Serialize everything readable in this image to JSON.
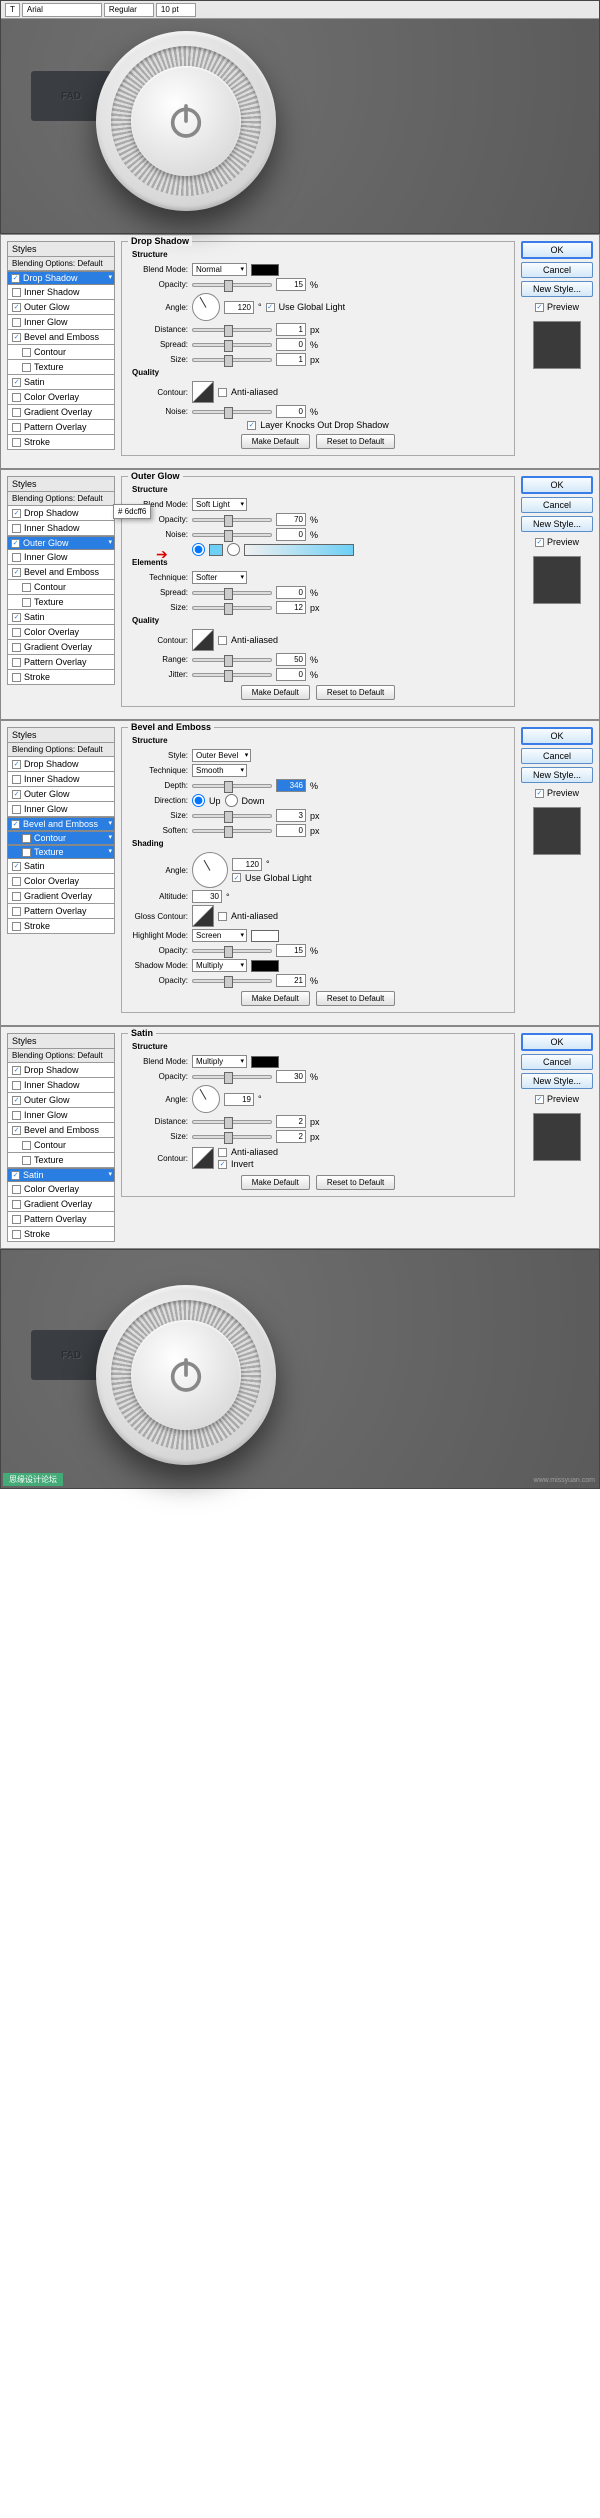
{
  "toolbar": {
    "font": "Arial",
    "weight": "Regular",
    "size": "10 pt",
    "unit": "T"
  },
  "fad": "FAD",
  "styles": {
    "header": "Styles",
    "blending": "Blending Options: Default",
    "items": [
      "Drop Shadow",
      "Inner Shadow",
      "Outer Glow",
      "Inner Glow",
      "Bevel and Emboss",
      "Contour",
      "Texture",
      "Satin",
      "Color Overlay",
      "Gradient Overlay",
      "Pattern Overlay",
      "Stroke"
    ]
  },
  "panels": {
    "dropshadow": {
      "title": "Drop Shadow",
      "structure": "Structure",
      "quality": "Quality",
      "blend_label": "Blend Mode:",
      "blend_val": "Normal",
      "opacity_label": "Opacity:",
      "opacity_val": "15",
      "pct": "%",
      "angle_label": "Angle:",
      "angle_val": "120",
      "deg": "°",
      "ugl": "Use Global Light",
      "distance_label": "Distance:",
      "distance_val": "1",
      "px": "px",
      "spread_label": "Spread:",
      "spread_val": "0",
      "size_label": "Size:",
      "size_val": "1",
      "contour_label": "Contour:",
      "aa": "Anti-aliased",
      "noise_label": "Noise:",
      "noise_val": "0",
      "knockout": "Layer Knocks Out Drop Shadow",
      "make_default": "Make Default",
      "reset": "Reset to Default"
    },
    "outerglow": {
      "title": "Outer Glow",
      "structure": "Structure",
      "elements": "Elements",
      "quality": "Quality",
      "blend_label": "Blend Mode:",
      "blend_val": "Soft Light",
      "opacity_label": "Opacity:",
      "opacity_val": "70",
      "pct": "%",
      "noise_label": "Noise:",
      "noise_val": "0",
      "technique_label": "Technique:",
      "technique_val": "Softer",
      "spread_label": "Spread:",
      "spread_val": "0",
      "size_label": "Size:",
      "size_val": "12",
      "px": "px",
      "contour_label": "Contour:",
      "aa": "Anti-aliased",
      "range_label": "Range:",
      "range_val": "50",
      "jitter_label": "Jitter:",
      "jitter_val": "0",
      "color_hex": "# 6dcff6",
      "make_default": "Make Default",
      "reset": "Reset to Default"
    },
    "bevel": {
      "title": "Bevel and Emboss",
      "structure": "Structure",
      "shading": "Shading",
      "style_label": "Style:",
      "style_val": "Outer Bevel",
      "technique_label": "Technique:",
      "technique_val": "Smooth",
      "depth_label": "Depth:",
      "depth_val": "346",
      "pct": "%",
      "direction_label": "Direction:",
      "up": "Up",
      "down": "Down",
      "size_label": "Size:",
      "size_val": "3",
      "px": "px",
      "soften_label": "Soften:",
      "soften_val": "0",
      "angle_label": "Angle:",
      "angle_val": "120",
      "deg": "°",
      "ugl": "Use Global Light",
      "altitude_label": "Altitude:",
      "altitude_val": "30",
      "gloss_label": "Gloss Contour:",
      "aa": "Anti-aliased",
      "hmode_label": "Highlight Mode:",
      "hmode_val": "Screen",
      "hopacity_label": "Opacity:",
      "hopacity_val": "15",
      "smode_label": "Shadow Mode:",
      "smode_val": "Multiply",
      "sopacity_label": "Opacity:",
      "sopacity_val": "21",
      "make_default": "Make Default",
      "reset": "Reset to Default"
    },
    "satin": {
      "title": "Satin",
      "structure": "Structure",
      "blend_label": "Blend Mode:",
      "blend_val": "Multiply",
      "opacity_label": "Opacity:",
      "opacity_val": "30",
      "pct": "%",
      "angle_label": "Angle:",
      "angle_val": "19",
      "deg": "°",
      "distance_label": "Distance:",
      "distance_val": "2",
      "px": "px",
      "size_label": "Size:",
      "size_val": "2",
      "contour_label": "Contour:",
      "aa": "Anti-aliased",
      "invert": "Invert",
      "make_default": "Make Default",
      "reset": "Reset to Default"
    }
  },
  "buttons": {
    "ok": "OK",
    "cancel": "Cancel",
    "new_style": "New Style...",
    "preview": "Preview"
  },
  "brand": "思缘设计论坛",
  "watermark": "www.missyuan.com"
}
